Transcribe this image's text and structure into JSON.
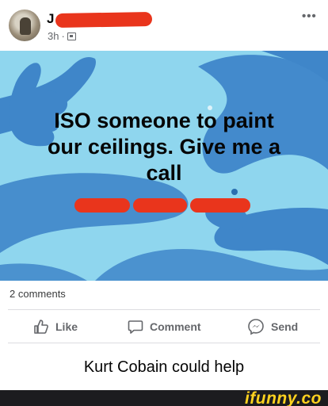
{
  "post": {
    "author_initial": "J",
    "time": "3h",
    "separator": "·",
    "audience_icon": "group-icon",
    "more_label": "•••",
    "text_lines": [
      "ISO someone to paint",
      "our ceilings. Give me a",
      "call"
    ]
  },
  "stats": {
    "comments": "2 comments"
  },
  "actions": [
    {
      "label": "Like",
      "icon": "thumbs-up-icon"
    },
    {
      "label": "Comment",
      "icon": "comment-bubble-icon"
    },
    {
      "label": "Send",
      "icon": "messenger-icon"
    }
  ],
  "caption": "Kurt Cobain could help",
  "watermark": "ifunny.co",
  "colors": {
    "image_bg": "#8fd6ee",
    "hand_blue": "#3f86c9",
    "redaction": "#e9351c",
    "watermark_yellow": "#ffd21f"
  }
}
